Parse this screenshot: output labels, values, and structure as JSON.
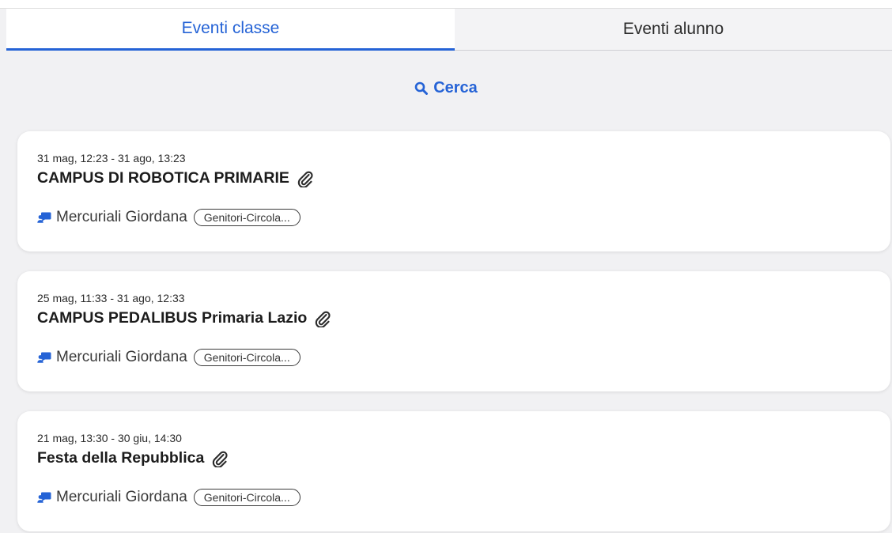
{
  "tabs": [
    {
      "label": "Eventi classe",
      "active": true
    },
    {
      "label": "Eventi alunno",
      "active": false
    }
  ],
  "search": {
    "label": "Cerca",
    "icon": "search-icon"
  },
  "events": [
    {
      "date_range": "31 mag, 12:23 - 31 ago, 13:23",
      "title": "CAMPUS DI ROBOTICA PRIMARIE",
      "attachment_icon": "paperclip-icon",
      "author": "Mercuriali Giordana",
      "author_icon": "teacher-icon",
      "tag": "Genitori-Circola..."
    },
    {
      "date_range": "25 mag, 11:33 - 31 ago, 12:33",
      "title": "CAMPUS PEDALIBUS Primaria Lazio",
      "attachment_icon": "paperclip-icon",
      "author": "Mercuriali Giordana",
      "author_icon": "teacher-icon",
      "tag": "Genitori-Circola..."
    },
    {
      "date_range": "21 mag, 13:30 - 30 giu, 14:30",
      "title": "Festa della Repubblica",
      "attachment_icon": "paperclip-icon",
      "author": "Mercuriali Giordana",
      "author_icon": "teacher-icon",
      "tag": "Genitori-Circola..."
    }
  ],
  "colors": {
    "accent": "#2563d6",
    "background": "#f1f1f3",
    "card": "#ffffff"
  }
}
